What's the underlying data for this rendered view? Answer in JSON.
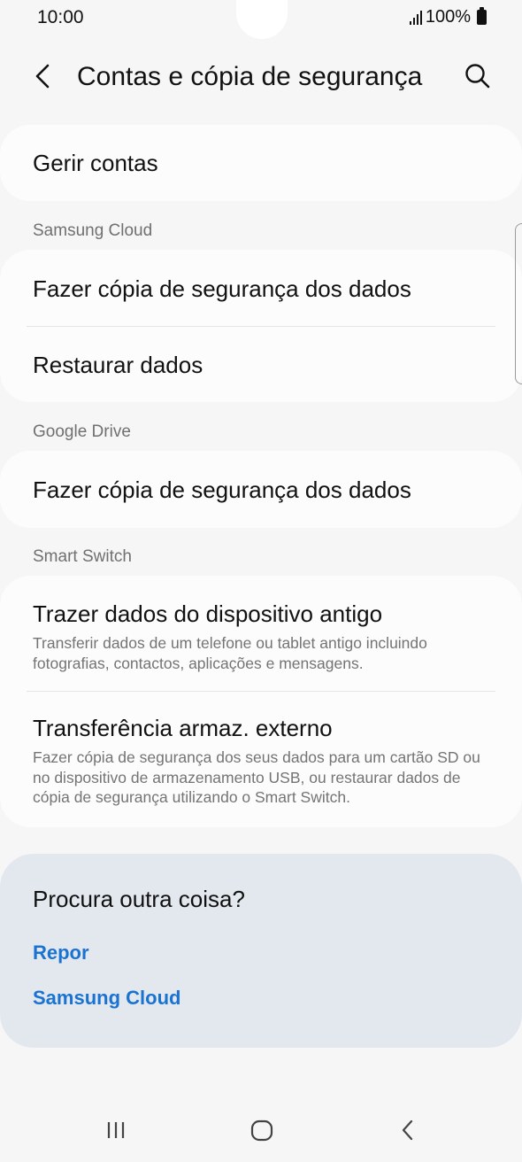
{
  "status_bar": {
    "time": "10:00",
    "battery": "100%"
  },
  "header": {
    "title": "Contas e cópia de segurança"
  },
  "manage_accounts": {
    "label": "Gerir contas"
  },
  "samsung_cloud": {
    "section_label": "Samsung Cloud",
    "items": [
      {
        "title": "Fazer cópia de segurança dos dados"
      },
      {
        "title": "Restaurar dados"
      }
    ]
  },
  "google_drive": {
    "section_label": "Google Drive",
    "items": [
      {
        "title": "Fazer cópia de segurança dos dados"
      }
    ]
  },
  "smart_switch": {
    "section_label": "Smart Switch",
    "items": [
      {
        "title": "Trazer dados do dispositivo antigo",
        "subtitle": "Transferir dados de um telefone ou tablet antigo incluindo fotografias, contactos, aplicações e mensagens."
      },
      {
        "title": "Transferência armaz. externo",
        "subtitle": "Fazer cópia de segurança dos seus dados para um cartão SD ou no dispositivo de armazenamento USB, ou restaurar dados de cópia de segurança utilizando o Smart Switch."
      }
    ]
  },
  "lookup": {
    "title": "Procura outra coisa?",
    "links": [
      "Repor",
      "Samsung Cloud"
    ]
  },
  "colors": {
    "background": "#f6f6f6",
    "card": "#fcfcfc",
    "lookup_card": "#e3e8ef",
    "link": "#1b73d1",
    "secondary_text": "#747474"
  },
  "icons": {
    "back": "back-arrow-icon",
    "search": "search-icon",
    "signal": "signal-icon",
    "battery": "battery-icon",
    "recents": "recents-icon",
    "home": "home-icon",
    "nav_back": "nav-back-icon"
  }
}
